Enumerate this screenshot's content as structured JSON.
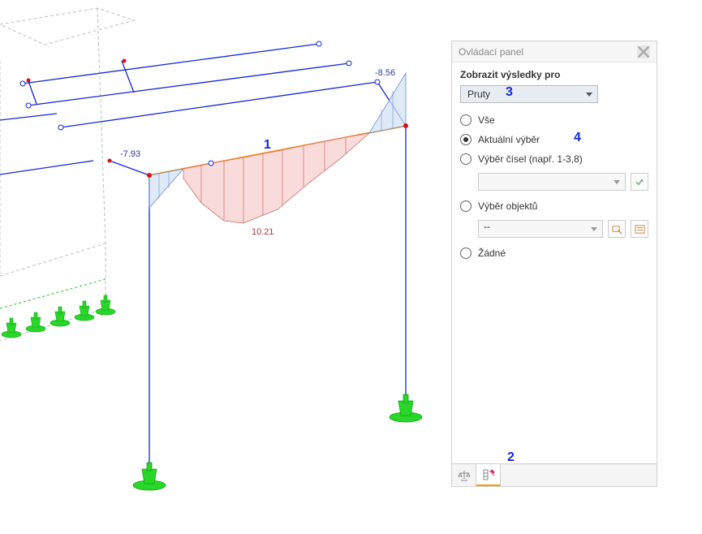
{
  "panel": {
    "title": "Ovládací panel",
    "section_title": "Zobrazit výsledky pro",
    "entity_select": "Pruty",
    "radios": {
      "all": "Vše",
      "current": "Aktuální výběr",
      "numbers": "Výběr čísel (např. 1-3,8)",
      "objects": "Výběr objektů",
      "none": "Žádné"
    },
    "numbers_value": "",
    "objects_value": "--"
  },
  "annotations": {
    "a1": "1",
    "a2": "2",
    "a3": "3",
    "a4": "4"
  },
  "diagram": {
    "values": {
      "left_neg": "-7.93",
      "right_neg": "-8.56",
      "mid_pos": "10.21"
    }
  }
}
